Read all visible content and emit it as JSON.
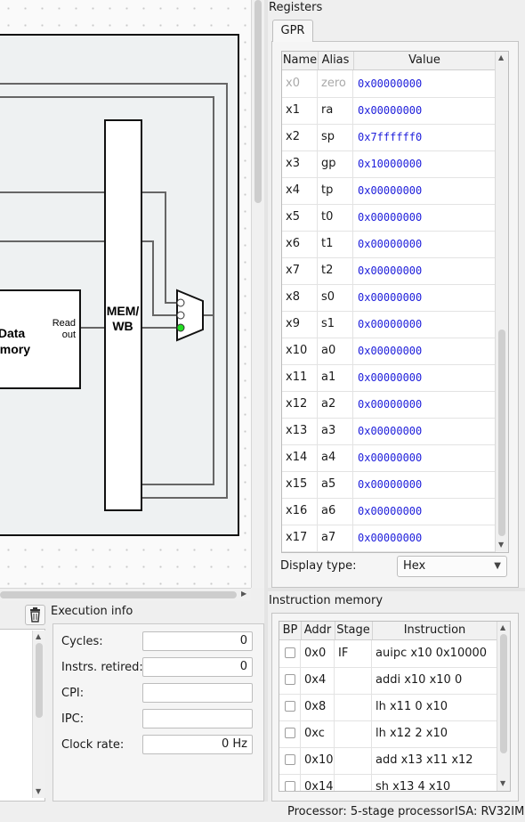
{
  "registers": {
    "title": "Registers",
    "tab": "GPR",
    "columns": [
      "Name",
      "Alias",
      "Value"
    ],
    "rows": [
      {
        "name": "x0",
        "alias": "zero",
        "value": "0x00000000"
      },
      {
        "name": "x1",
        "alias": "ra",
        "value": "0x00000000"
      },
      {
        "name": "x2",
        "alias": "sp",
        "value": "0x7ffffff0"
      },
      {
        "name": "x3",
        "alias": "gp",
        "value": "0x10000000"
      },
      {
        "name": "x4",
        "alias": "tp",
        "value": "0x00000000"
      },
      {
        "name": "x5",
        "alias": "t0",
        "value": "0x00000000"
      },
      {
        "name": "x6",
        "alias": "t1",
        "value": "0x00000000"
      },
      {
        "name": "x7",
        "alias": "t2",
        "value": "0x00000000"
      },
      {
        "name": "x8",
        "alias": "s0",
        "value": "0x00000000"
      },
      {
        "name": "x9",
        "alias": "s1",
        "value": "0x00000000"
      },
      {
        "name": "x10",
        "alias": "a0",
        "value": "0x00000000"
      },
      {
        "name": "x11",
        "alias": "a1",
        "value": "0x00000000"
      },
      {
        "name": "x12",
        "alias": "a2",
        "value": "0x00000000"
      },
      {
        "name": "x13",
        "alias": "a3",
        "value": "0x00000000"
      },
      {
        "name": "x14",
        "alias": "a4",
        "value": "0x00000000"
      },
      {
        "name": "x15",
        "alias": "a5",
        "value": "0x00000000"
      },
      {
        "name": "x16",
        "alias": "a6",
        "value": "0x00000000"
      },
      {
        "name": "x17",
        "alias": "a7",
        "value": "0x00000000"
      }
    ],
    "display_type_label": "Display type:",
    "display_type_value": "Hex"
  },
  "instruction_memory": {
    "title": "Instruction memory",
    "columns": [
      "BP",
      "Addr",
      "Stage",
      "Instruction"
    ],
    "rows": [
      {
        "addr": "0x0",
        "stage": "IF",
        "instruction": "auipc x10 0x10000"
      },
      {
        "addr": "0x4",
        "stage": "",
        "instruction": "addi x10 x10 0"
      },
      {
        "addr": "0x8",
        "stage": "",
        "instruction": "lh x11 0 x10"
      },
      {
        "addr": "0xc",
        "stage": "",
        "instruction": "lh x12 2 x10"
      },
      {
        "addr": "0x10",
        "stage": "",
        "instruction": "add x13 x11 x12"
      },
      {
        "addr": "0x14",
        "stage": "",
        "instruction": "sh x13 4 x10"
      }
    ]
  },
  "execution_info": {
    "title": "Execution info",
    "fields": [
      {
        "label": "Cycles:",
        "value": "0"
      },
      {
        "label": "Instrs. retired:",
        "value": "0"
      },
      {
        "label": "CPI:",
        "value": ""
      },
      {
        "label": "IPC:",
        "value": ""
      },
      {
        "label": "Clock rate:",
        "value": "0 Hz"
      }
    ]
  },
  "diagram": {
    "data_memory_label_line1": "Data",
    "data_memory_label_line2": "emory",
    "read_out_line1": "Read",
    "read_out_line2": "out",
    "pipeline_reg_line1": "MEM/",
    "pipeline_reg_line2": "WB"
  },
  "status_bar": {
    "processor": "Processor: 5-stage processor",
    "isa": "ISA: RV32IM"
  },
  "colors": {
    "register_value": "#1d1ddb",
    "mux_active_input": "#22dd22"
  },
  "icons": [
    "trash-icon",
    "chevron-down-icon",
    "scroll-arrow-up-icon",
    "scroll-arrow-down-icon",
    "scroll-arrow-right-icon"
  ]
}
